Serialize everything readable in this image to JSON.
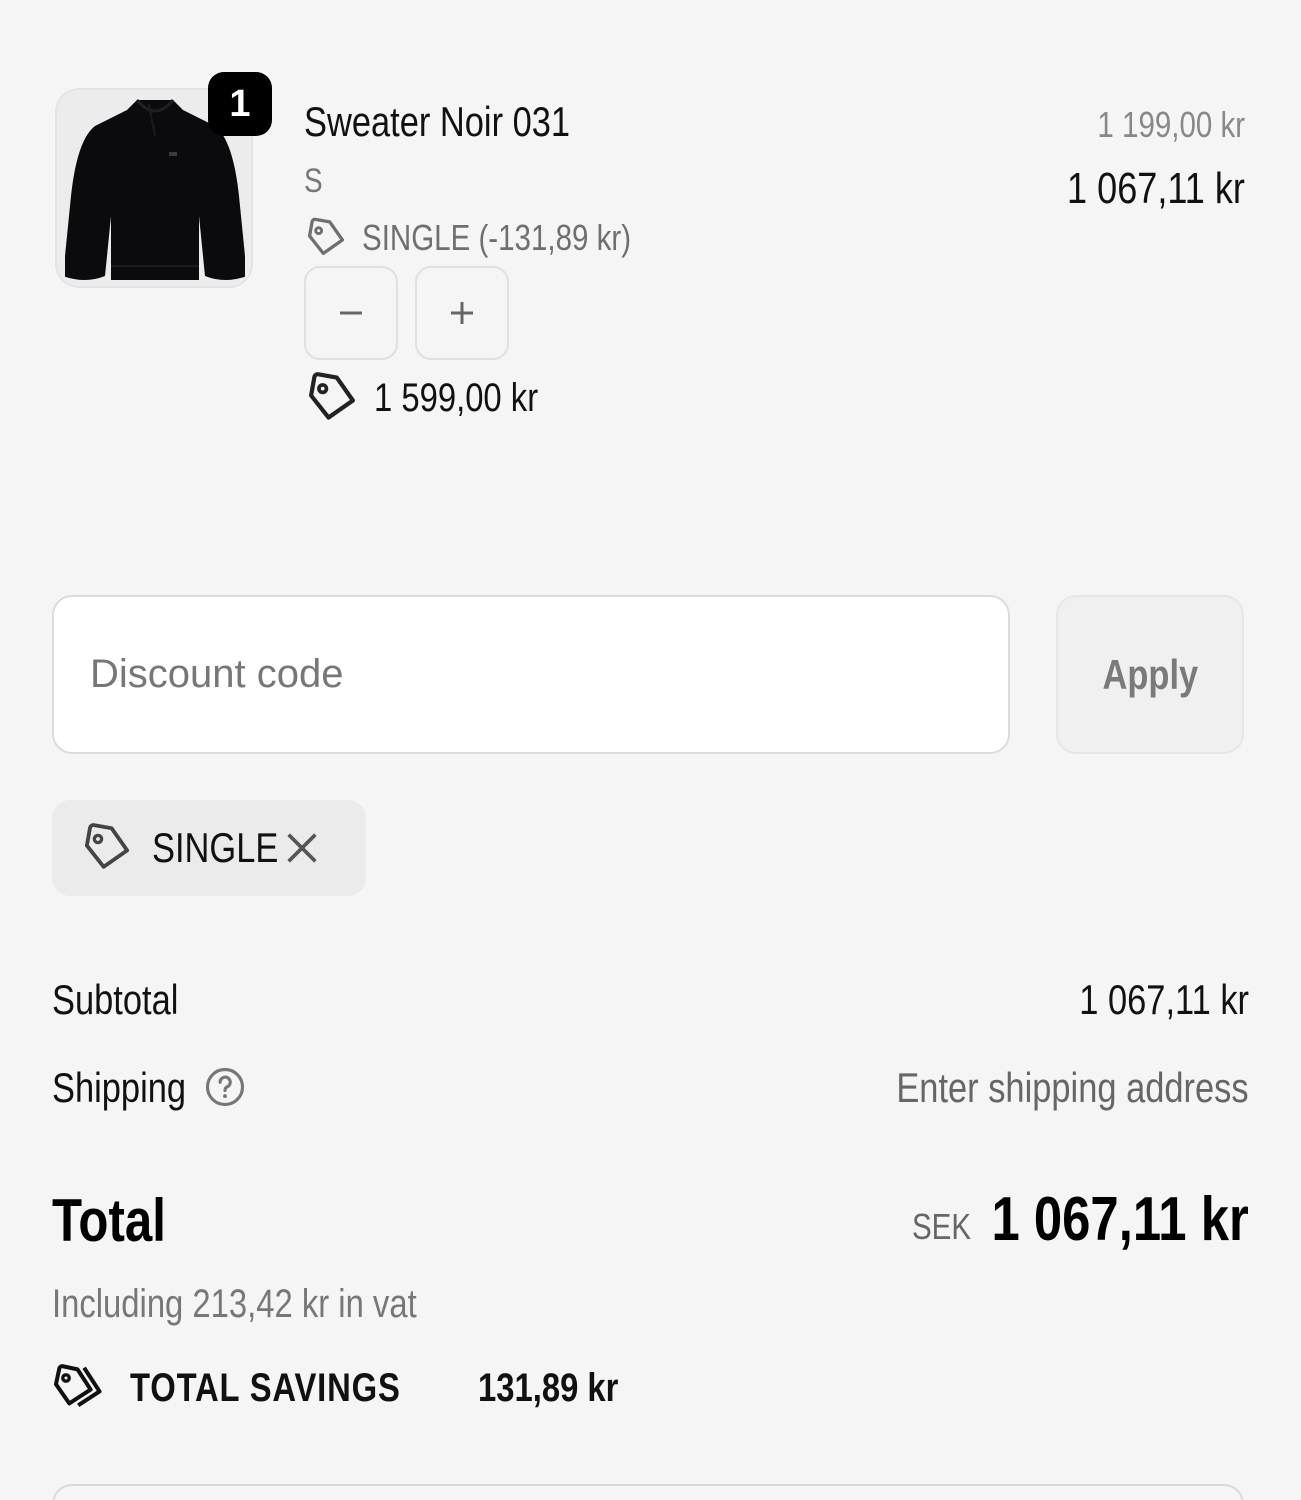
{
  "line_item": {
    "quantity": "1",
    "name": "Sweater Noir 031",
    "variant": "S",
    "discount_label": "SINGLE (-131,89 kr)",
    "original_unit_price": "1 599,00 kr",
    "compare_price": "1 199,00 kr",
    "price": "1 067,11 kr",
    "decrease_symbol": "−",
    "increase_symbol": "+"
  },
  "discount_form": {
    "placeholder": "Discount code",
    "value": "",
    "apply_label": "Apply"
  },
  "applied_codes": [
    {
      "code": "SINGLE"
    }
  ],
  "summary": {
    "subtotal_label": "Subtotal",
    "subtotal_value": "1 067,11 kr",
    "shipping_label": "Shipping",
    "shipping_value": "Enter shipping address",
    "total_label": "Total",
    "currency": "SEK",
    "total_value": "1 067,11 kr",
    "vat_note": "Including 213,42 kr in vat",
    "savings_label": "TOTAL SAVINGS",
    "savings_value": "131,89 kr"
  },
  "icons": {
    "thumbnail": "black-sweater-image",
    "tag": "tag-icon",
    "tags": "tags-icon",
    "help": "question-circle-icon",
    "remove": "close-icon"
  },
  "colors": {
    "background": "#f5f5f5",
    "text": "#111111",
    "muted": "#777777",
    "badge": "#000000"
  }
}
